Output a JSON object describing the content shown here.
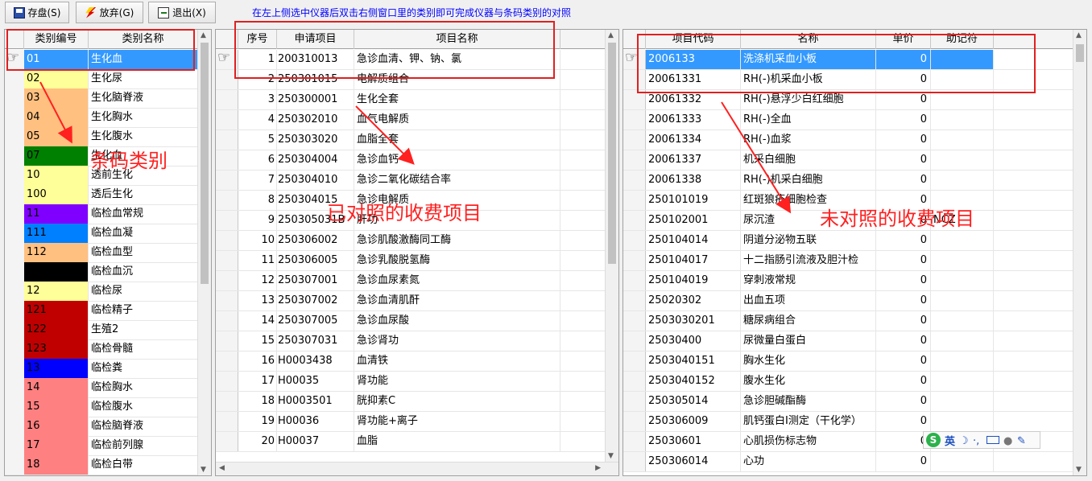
{
  "toolbar": {
    "save_label": "存盘(S)",
    "discard_label": "放弃(G)",
    "exit_label": "退出(X)",
    "hint": "在左上侧选中仪器后双击右侧窗口里的类别即可完成仪器与条码类别的对照"
  },
  "category_grid": {
    "headers": [
      "类别编号",
      "类别名称"
    ],
    "rows": [
      {
        "code": "01",
        "name": "生化血",
        "color": "#3399ff",
        "selected": true
      },
      {
        "code": "02",
        "name": "生化尿",
        "color": "#ffff99"
      },
      {
        "code": "03",
        "name": "生化脑脊液",
        "color": "#ffc080"
      },
      {
        "code": "04",
        "name": "生化胸水",
        "color": "#ffc080"
      },
      {
        "code": "05",
        "name": "生化腹水",
        "color": "#ffc080"
      },
      {
        "code": "07",
        "name": "生化血",
        "color": "#008000"
      },
      {
        "code": "10",
        "name": "透前生化",
        "color": "#ffff99"
      },
      {
        "code": "100",
        "name": "透后生化",
        "color": "#ffff99"
      },
      {
        "code": "11",
        "name": "临检血常规",
        "color": "#8000ff"
      },
      {
        "code": "111",
        "name": "临检血凝",
        "color": "#0080ff"
      },
      {
        "code": "112",
        "name": "临检血型",
        "color": "#ffc080"
      },
      {
        "code": "",
        "name": "临检血沉",
        "color": "#000000"
      },
      {
        "code": "12",
        "name": "临检尿",
        "color": "#ffff99"
      },
      {
        "code": "121",
        "name": "临检精子",
        "color": "#c00000"
      },
      {
        "code": "122",
        "name": "生殖2",
        "color": "#c00000"
      },
      {
        "code": "123",
        "name": "临检骨髓",
        "color": "#c00000"
      },
      {
        "code": "13",
        "name": "临检粪",
        "color": "#0000ff"
      },
      {
        "code": "14",
        "name": "临检胸水",
        "color": "#ff8080"
      },
      {
        "code": "15",
        "name": "临检腹水",
        "color": "#ff8080"
      },
      {
        "code": "16",
        "name": "临检脑脊液",
        "color": "#ff8080"
      },
      {
        "code": "17",
        "name": "临检前列腺",
        "color": "#ff8080"
      },
      {
        "code": "18",
        "name": "临检白带",
        "color": "#ff8080"
      }
    ]
  },
  "mapped_grid": {
    "headers": [
      "序号",
      "申请项目",
      "项目名称"
    ],
    "rows": [
      {
        "seq": "1",
        "code": "200310013",
        "name": "急诊血清、钾、钠、氯",
        "selected": true
      },
      {
        "seq": "2",
        "code": "250301015",
        "name": "电解质组合"
      },
      {
        "seq": "3",
        "code": "250300001",
        "name": "生化全套"
      },
      {
        "seq": "4",
        "code": "250302010",
        "name": "血气电解质"
      },
      {
        "seq": "5",
        "code": "250303020",
        "name": "血脂全套"
      },
      {
        "seq": "6",
        "code": "250304004",
        "name": "急诊血钙"
      },
      {
        "seq": "7",
        "code": "250304010",
        "name": "急诊二氧化碳结合率"
      },
      {
        "seq": "8",
        "code": "250304015",
        "name": "急诊电解质"
      },
      {
        "seq": "9",
        "code": "250305031B",
        "name": "肝功"
      },
      {
        "seq": "10",
        "code": "250306002",
        "name": "急诊肌酸激酶同工酶"
      },
      {
        "seq": "11",
        "code": "250306005",
        "name": "急诊乳酸脱氢酶"
      },
      {
        "seq": "12",
        "code": "250307001",
        "name": "急诊血尿素氮"
      },
      {
        "seq": "13",
        "code": "250307002",
        "name": "急诊血清肌酐"
      },
      {
        "seq": "14",
        "code": "250307005",
        "name": "急诊血尿酸"
      },
      {
        "seq": "15",
        "code": "250307031",
        "name": "急诊肾功"
      },
      {
        "seq": "16",
        "code": "H0003438",
        "name": "血清铁"
      },
      {
        "seq": "17",
        "code": "H00035",
        "name": "肾功能"
      },
      {
        "seq": "18",
        "code": "H0003501",
        "name": "胱抑素C"
      },
      {
        "seq": "19",
        "code": "H00036",
        "name": "肾功能+离子"
      },
      {
        "seq": "20",
        "code": "H00037",
        "name": "血脂"
      }
    ]
  },
  "unmapped_grid": {
    "headers": [
      "项目代码",
      "名称",
      "单价",
      "助记符"
    ],
    "rows": [
      {
        "code": "2006133",
        "name": "洗涤机采血小板",
        "price": "0",
        "mnemonic": "",
        "selected": true
      },
      {
        "code": "20061331",
        "name": "RH(-)机采血小板",
        "price": "0",
        "mnemonic": ""
      },
      {
        "code": "20061332",
        "name": "RH(-)悬浮少白红细胞",
        "price": "0",
        "mnemonic": ""
      },
      {
        "code": "20061333",
        "name": "RH(-)全血",
        "price": "0",
        "mnemonic": ""
      },
      {
        "code": "20061334",
        "name": "RH(-)血浆",
        "price": "0",
        "mnemonic": ""
      },
      {
        "code": "20061337",
        "name": "机采白细胞",
        "price": "0",
        "mnemonic": ""
      },
      {
        "code": "20061338",
        "name": "RH(-)机采白细胞",
        "price": "0",
        "mnemonic": ""
      },
      {
        "code": "250101019",
        "name": "红斑狼疮细胞检查",
        "price": "0",
        "mnemonic": ""
      },
      {
        "code": "250102001",
        "name": "尿沉渣",
        "price": "0",
        "mnemonic": "NCZ"
      },
      {
        "code": "250104014",
        "name": "阴道分泌物五联",
        "price": "0",
        "mnemonic": ""
      },
      {
        "code": "250104017",
        "name": "十二指肠引流液及胆汁检",
        "price": "0",
        "mnemonic": ""
      },
      {
        "code": "250104019",
        "name": "穿刺液常规",
        "price": "0",
        "mnemonic": ""
      },
      {
        "code": "25020302",
        "name": "出血五项",
        "price": "0",
        "mnemonic": ""
      },
      {
        "code": "2503030201",
        "name": "糖尿病组合",
        "price": "0",
        "mnemonic": ""
      },
      {
        "code": "25030400",
        "name": "尿微量白蛋白",
        "price": "0",
        "mnemonic": ""
      },
      {
        "code": "2503040151",
        "name": "胸水生化",
        "price": "0",
        "mnemonic": ""
      },
      {
        "code": "2503040152",
        "name": "腹水生化",
        "price": "0",
        "mnemonic": ""
      },
      {
        "code": "250305014",
        "name": "急诊胆碱酯酶",
        "price": "0",
        "mnemonic": ""
      },
      {
        "code": "250306009",
        "name": "肌钙蛋白I测定（干化学）",
        "price": "0",
        "mnemonic": ""
      },
      {
        "code": "25030601",
        "name": "心肌损伤标志物",
        "price": "0",
        "mnemonic": ""
      },
      {
        "code": "250306014",
        "name": "心功",
        "price": "0",
        "mnemonic": ""
      }
    ]
  },
  "annotations": {
    "barcode_category": "条码类别",
    "mapped_items": "已对照的收费项目",
    "unmapped_items": "未对照的收费项目",
    "color": "#ff2020"
  },
  "ime": {
    "logo": "S",
    "lang": "英"
  }
}
